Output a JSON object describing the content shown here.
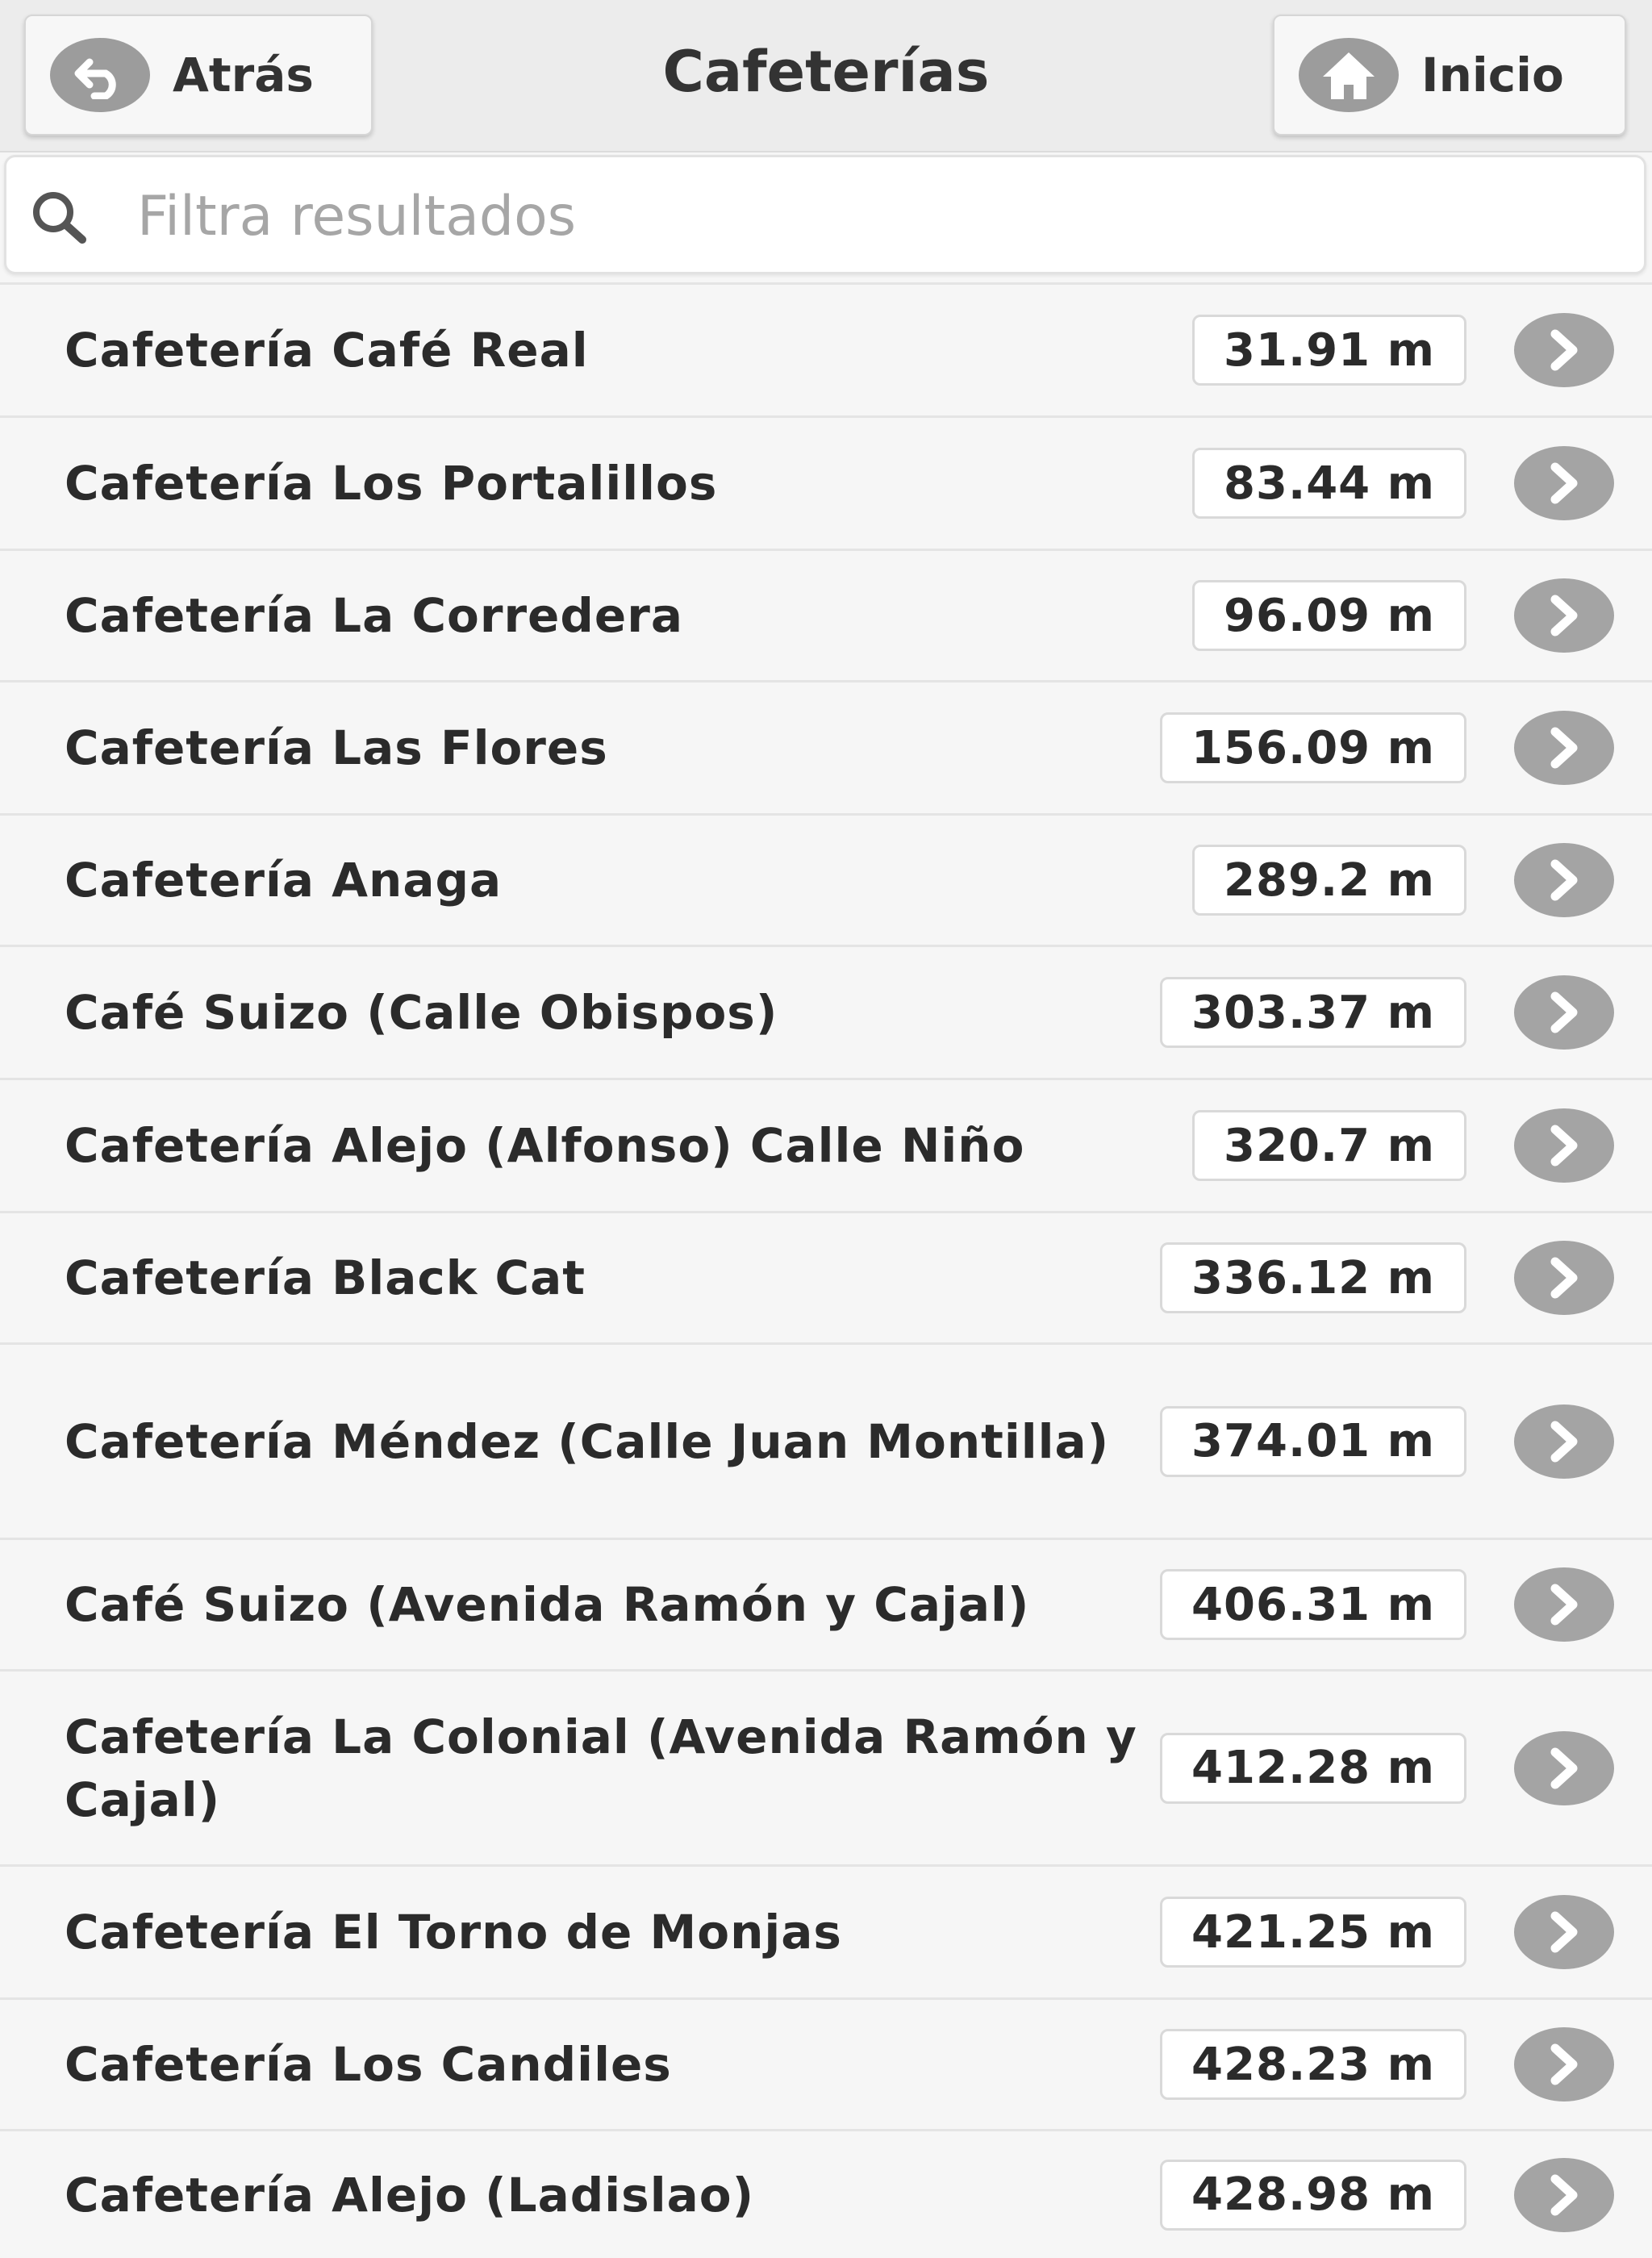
{
  "header": {
    "title": "Cafeterías",
    "back_label": "Atrás",
    "home_label": "Inicio"
  },
  "search": {
    "placeholder": "Filtra resultados",
    "value": ""
  },
  "items": [
    {
      "name": "Cafetería Café Real",
      "distance": "31.91 m"
    },
    {
      "name": "Cafetería Los Portalillos",
      "distance": "83.44 m"
    },
    {
      "name": "Cafetería La Corredera",
      "distance": "96.09 m"
    },
    {
      "name": "Cafetería Las Flores",
      "distance": "156.09 m"
    },
    {
      "name": "Cafetería Anaga",
      "distance": "289.2 m"
    },
    {
      "name": "Café Suizo (Calle Obispos)",
      "distance": "303.37 m"
    },
    {
      "name": "Cafetería Alejo (Alfonso) Calle Niño",
      "distance": "320.7 m"
    },
    {
      "name": "Cafetería Black Cat",
      "distance": "336.12 m"
    },
    {
      "name": "Cafetería Méndez (Calle Juan Montilla)",
      "distance": "374.01 m"
    },
    {
      "name": "Café Suizo (Avenida Ramón y Cajal)",
      "distance": "406.31 m"
    },
    {
      "name": "Cafetería La Colonial (Avenida Ramón y Cajal)",
      "distance": "412.28 m"
    },
    {
      "name": "Cafetería El Torno de Monjas",
      "distance": "421.25 m"
    },
    {
      "name": "Cafetería Los Candiles",
      "distance": "428.23 m"
    },
    {
      "name": "Cafetería Alejo (Ladislao)",
      "distance": "428.98 m"
    }
  ],
  "icons": {
    "back": "back-arrow-icon",
    "home": "home-icon",
    "search": "search-icon",
    "row": "chevron-right-icon"
  },
  "colors": {
    "header_bg": "#ececec",
    "icon_circle": "#9c9c9c",
    "page_bg": "#f6f6f6"
  }
}
